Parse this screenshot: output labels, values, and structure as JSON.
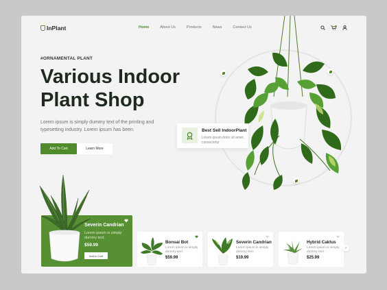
{
  "logo": {
    "text": "InPlant"
  },
  "nav": {
    "items": [
      "Home",
      "About Us",
      "Products",
      "News",
      "Contact Us"
    ]
  },
  "header_icons": [
    "search-icon",
    "cart-icon",
    "user-icon"
  ],
  "hero": {
    "kicker": "#ORNAMENTAL PLANT",
    "title_line1": "Various Indoor",
    "title_line2": "Plant Shop",
    "description": "Lorem ipsum is simply dummy text of the printing and typesetting industry. Lorem ipsum has been.",
    "primary_button": "Add To Cart",
    "secondary_button": "Learn More"
  },
  "best_sell": {
    "title": "Best Sell IndoorPlant",
    "description": "Lorem ipsum dolor sit amet, consectetur"
  },
  "featured": {
    "name": "Severin Candrian",
    "description": "Lorem ipsum is simply dummy text.",
    "price": "$59.99",
    "button": "Add to Cart"
  },
  "products": [
    {
      "name": "Bonsai Bot",
      "description": "Lorem ipsum is simply dummy text.",
      "price": "$59.99",
      "liked": true
    },
    {
      "name": "Severin Candrian",
      "description": "Lorem ipsum is simply dummy text.",
      "price": "$19.99",
      "liked": false
    },
    {
      "name": "Hybrid Caktus",
      "description": "Lorem ipsum is simply dummy text.",
      "price": "$25.99",
      "liked": false
    }
  ],
  "next_arrow": "›",
  "colors": {
    "brand_green": "#4f8a2b",
    "card_green": "#578f33",
    "background": "#f3f3f3",
    "outer": "#c9c9c9"
  }
}
